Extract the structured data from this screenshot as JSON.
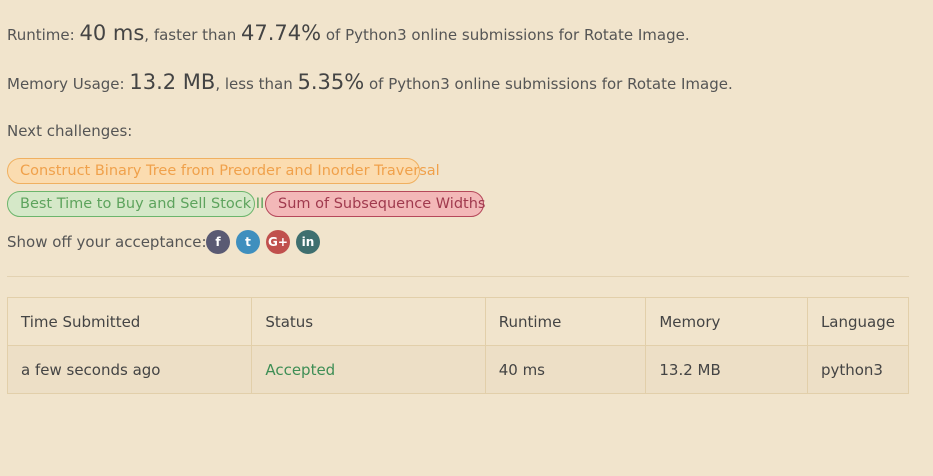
{
  "runtime": {
    "label": "Runtime: ",
    "value": "40 ms",
    "mid": ", faster than ",
    "percent": "47.74%",
    "suffix": " of Python3 online submissions for Rotate Image."
  },
  "memory": {
    "label": "Memory Usage: ",
    "value": "13.2 MB",
    "mid": ", less than ",
    "percent": "5.35%",
    "suffix": " of Python3 online submissions for Rotate Image."
  },
  "next_challenges": {
    "label": "Next challenges:",
    "items": [
      {
        "title": "Construct Binary Tree from Preorder and Inorder Traversal",
        "difficulty": "medium",
        "color": "#f0a14b"
      },
      {
        "title": "Best Time to Buy and Sell Stock II",
        "difficulty": "easy",
        "color": "#5da35d"
      },
      {
        "title": "Sum of Subsequence Widths",
        "difficulty": "hard",
        "color": "#a03a4e"
      }
    ]
  },
  "share": {
    "label": "Show off your acceptance:",
    "icons": [
      {
        "name": "facebook-icon",
        "glyph": "f"
      },
      {
        "name": "twitter-icon",
        "glyph": "t"
      },
      {
        "name": "google-plus-icon",
        "glyph": "G+"
      },
      {
        "name": "linkedin-icon",
        "glyph": "in"
      }
    ]
  },
  "table": {
    "headers": [
      "Time Submitted",
      "Status",
      "Runtime",
      "Memory",
      "Language"
    ],
    "rows": [
      [
        "a few seconds ago",
        "Accepted",
        "40 ms",
        "13.2 MB",
        "python3"
      ]
    ]
  },
  "colors": {
    "background": "#f1e4cc",
    "accepted": "#3e8e55"
  }
}
